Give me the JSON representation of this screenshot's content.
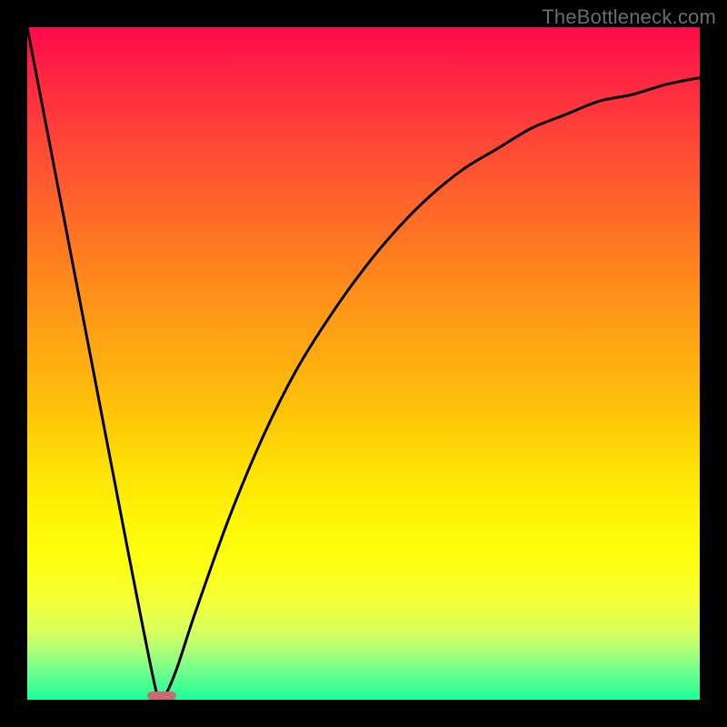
{
  "watermark": "TheBottleneck.com",
  "chart_data": {
    "type": "line",
    "title": "",
    "xlabel": "",
    "ylabel": "",
    "xlim": [
      0,
      100
    ],
    "ylim": [
      0,
      100
    ],
    "grid": false,
    "series": [
      {
        "name": "curve",
        "x": [
          0,
          5,
          10,
          15,
          19,
          20,
          22,
          25,
          30,
          35,
          40,
          45,
          50,
          55,
          60,
          65,
          70,
          75,
          80,
          85,
          90,
          95,
          100
        ],
        "values": [
          100,
          74,
          48,
          22,
          2,
          0,
          4,
          13,
          27,
          39,
          49,
          57,
          64,
          70,
          75,
          79,
          82,
          85,
          87,
          89,
          90,
          91.5,
          92.5
        ]
      }
    ],
    "marker": {
      "x_pct": 20,
      "width_pct": 4.2,
      "height_pct": 1.2
    },
    "colors": {
      "curve_stroke": "#000000",
      "marker_fill": "#cc6a72",
      "background_top": "#ff0a4a",
      "background_bottom": "#1aff9a",
      "frame": "#000000"
    }
  }
}
